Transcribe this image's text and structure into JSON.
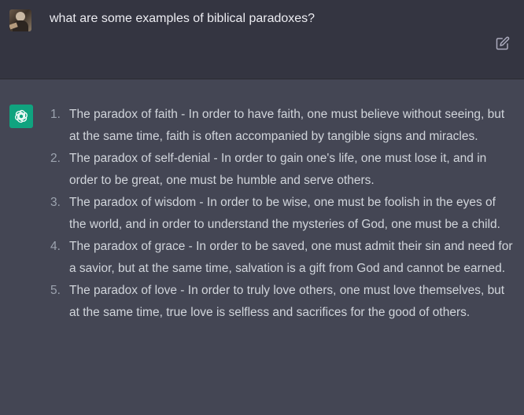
{
  "user_message": {
    "avatar_icon": "user-photo-avatar",
    "text": "what are some examples of biblical paradoxes?",
    "edit_icon": "edit-icon"
  },
  "assistant_message": {
    "avatar_icon": "openai-logo-icon",
    "avatar_color": "#10a37f",
    "items": [
      {
        "number": "1.",
        "text": "The paradox of faith - In order to have faith, one must believe without seeing, but at the same time, faith is often accompanied by tangible signs and miracles."
      },
      {
        "number": "2.",
        "text": "The paradox of self-denial - In order to gain one's life, one must lose it, and in order to be great, one must be humble and serve others."
      },
      {
        "number": "3.",
        "text": "The paradox of wisdom - In order to be wise, one must be foolish in the eyes of the world, and in order to understand the mysteries of God, one must be a child."
      },
      {
        "number": "4.",
        "text": "The paradox of grace - In order to be saved, one must admit their sin and need for a savior, but at the same time, salvation is a gift from God and cannot be earned."
      },
      {
        "number": "5.",
        "text": "The paradox of love - In order to truly love others, one must love themselves, but at the same time, true love is selfless and sacrifices for the good of others."
      }
    ]
  },
  "colors": {
    "user_bg": "#343541",
    "assistant_bg": "#444654",
    "text": "#d1d5db",
    "accent": "#10a37f"
  }
}
